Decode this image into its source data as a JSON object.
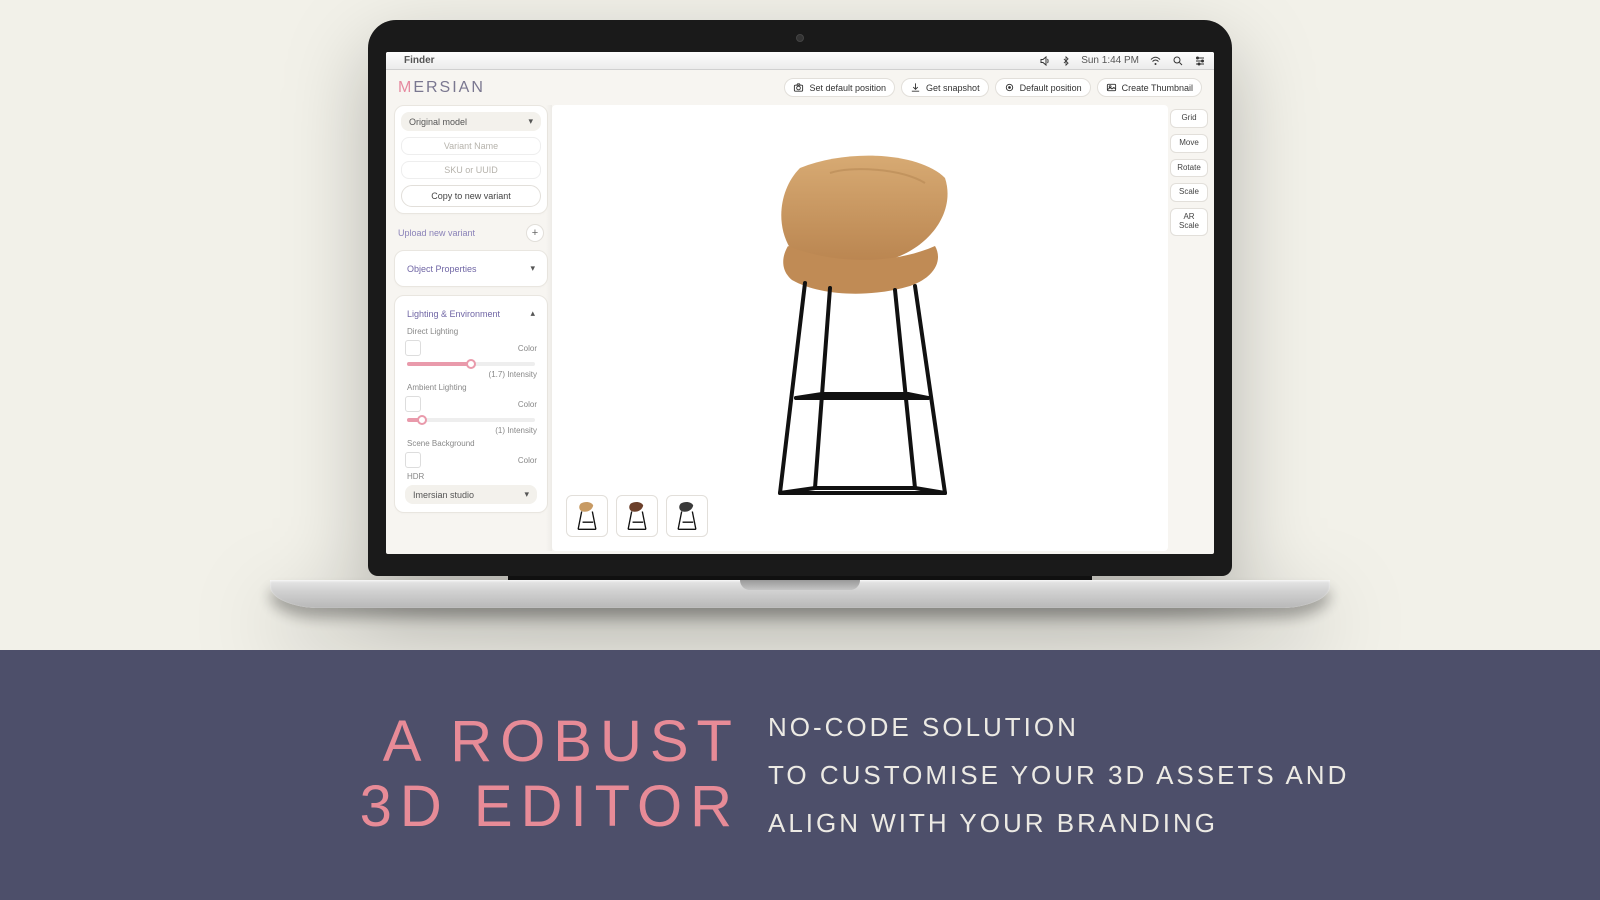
{
  "mac": {
    "app": "Finder",
    "clock": "Sun 1:44 PM"
  },
  "brand": {
    "pink": "M",
    "rest": "ERSIAN"
  },
  "topActions": [
    {
      "id": "set-default-position",
      "label": "Set default position",
      "icon": "camera"
    },
    {
      "id": "get-snapshot",
      "label": "Get snapshot",
      "icon": "download"
    },
    {
      "id": "default-position",
      "label": "Default position",
      "icon": "target"
    },
    {
      "id": "create-thumbnail",
      "label": "Create Thumbnail",
      "icon": "image"
    }
  ],
  "sidebar": {
    "variantSelect": "Original model",
    "variantNamePlaceholder": "Variant Name",
    "skuPlaceholder": "SKU or UUID",
    "copyBtn": "Copy to new variant",
    "uploadLabel": "Upload new variant",
    "objectProps": "Object Properties",
    "lighting": {
      "title": "Lighting & Environment",
      "direct": {
        "label": "Direct Lighting",
        "colorLabel": "Color",
        "intensity": 1.7,
        "intensityLabel": "(1.7) Intensity"
      },
      "ambient": {
        "label": "Ambient Lighting",
        "colorLabel": "Color",
        "intensity": 1.0,
        "intensityLabel": "(1) Intensity"
      },
      "scene": {
        "label": "Scene Background",
        "colorLabel": "Color"
      },
      "hdr": {
        "label": "HDR",
        "select": "Imersian studio"
      }
    }
  },
  "tools": [
    {
      "id": "grid",
      "label": "Grid"
    },
    {
      "id": "move",
      "label": "Move"
    },
    {
      "id": "rotate",
      "label": "Rotate"
    },
    {
      "id": "scale",
      "label": "Scale"
    },
    {
      "id": "ar-scale",
      "label": "AR\nScale"
    }
  ],
  "thumbnails": [
    {
      "id": "variant-tan",
      "seat": "#c79a63"
    },
    {
      "id": "variant-brown",
      "seat": "#6b3f2a"
    },
    {
      "id": "variant-black",
      "seat": "#3a3a3a"
    }
  ],
  "banner": {
    "headline1": "A ROBUST",
    "headline2": "3D EDITOR",
    "line1": "NO-CODE SOLUTION",
    "line2": "TO CUSTOMISE YOUR 3D ASSETS AND",
    "line3": "ALIGN WITH YOUR BRANDING"
  }
}
